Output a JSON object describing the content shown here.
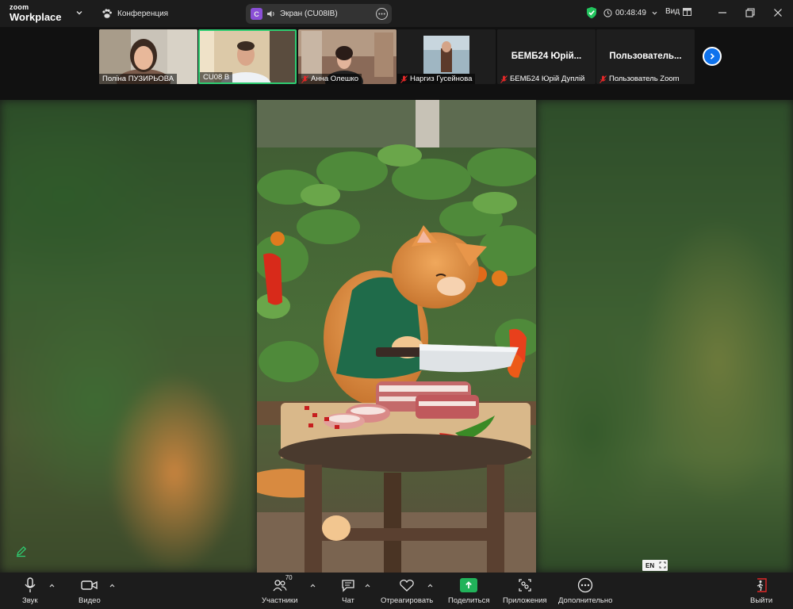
{
  "app": {
    "brand_top": "zoom",
    "brand_bottom": "Workplace"
  },
  "titlebar": {
    "meeting_label": "Конференция",
    "screen_label": "Экран (CU08IB)",
    "screen_badge": "C",
    "timer": "00:48:49",
    "view_label": "Вид"
  },
  "participants": [
    {
      "name": "Поліна ПУЗИРЬОВА",
      "muted": false,
      "video": true
    },
    {
      "name": "CU08 B",
      "muted": false,
      "video": true,
      "active": true
    },
    {
      "name": "Анна Олешко",
      "muted": true,
      "video": true
    },
    {
      "name": "Наргиз Гусейнова",
      "muted": true,
      "video": true
    },
    {
      "name": "БЕМБ24 Юрій Дуплій",
      "muted": true,
      "video": false,
      "title": "БЕМБ24 Юрій..."
    },
    {
      "name": "Пользователь Zoom",
      "muted": true,
      "video": false,
      "title": "Пользователь..."
    }
  ],
  "share_view": {
    "scene_description": "orange cat in green apron cutting meat on a stool in a pepper garden",
    "lang_indicator": "EN"
  },
  "toolbar": {
    "audio": "Звук",
    "video": "Видео",
    "participants": "Участники",
    "participants_count": "70",
    "chat": "Чат",
    "react": "Отреагировать",
    "share": "Поделиться",
    "apps": "Приложения",
    "more": "Дополнительно",
    "leave": "Выйти"
  },
  "colors": {
    "accent": "#0e72ed",
    "share_green": "#21b35a",
    "active_border": "#2ecc71",
    "muted_red": "#e02828"
  }
}
